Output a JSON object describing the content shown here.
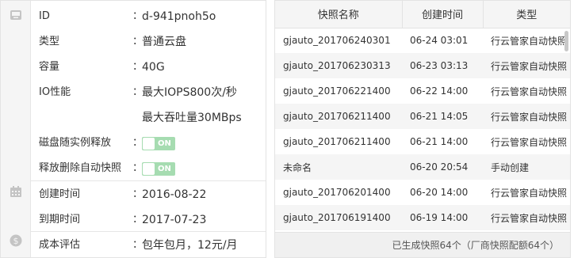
{
  "details": {
    "rows": [
      {
        "label": "ID",
        "value": "d-941pnoh5o"
      },
      {
        "label": "类型",
        "value": "普通云盘"
      },
      {
        "label": "容量",
        "value": "40G"
      },
      {
        "label": "IO性能",
        "value": "最大IOPS800次/秒",
        "value2": "最大吞吐量30MBps"
      },
      {
        "label": "磁盘随实例释放",
        "toggle": "ON"
      },
      {
        "label": "释放删除自动快照",
        "toggle": "ON"
      },
      {
        "label": "创建时间",
        "value": "2016-08-22"
      },
      {
        "label": "到期时间",
        "value": "2017-07-23"
      },
      {
        "label": "成本评估",
        "value": "包年包月，12元/月"
      }
    ],
    "colon": "："
  },
  "snapshots": {
    "headers": [
      "快照名称",
      "创建时间",
      "类型"
    ],
    "rows": [
      [
        "gjauto_201706240301",
        "06-24 03:01",
        "行云管家自动快照"
      ],
      [
        "gjauto_201706230313",
        "06-23 03:13",
        "行云管家自动快照"
      ],
      [
        "gjauto_201706221400",
        "06-22 14:00",
        "行云管家自动快照"
      ],
      [
        "gjauto_201706211400",
        "06-21 14:05",
        "行云管家自动快照"
      ],
      [
        "gjauto_201706211400",
        "06-21 14:00",
        "行云管家自动快照"
      ],
      [
        "未命名",
        "06-20 20:54",
        "手动创建"
      ],
      [
        "gjauto_201706201400",
        "06-20 14:00",
        "行云管家自动快照"
      ],
      [
        "gjauto_201706191400",
        "06-19 14:00",
        "行云管家自动快照"
      ]
    ],
    "footer": "已生成快照64个（厂商快照配额64个）"
  }
}
